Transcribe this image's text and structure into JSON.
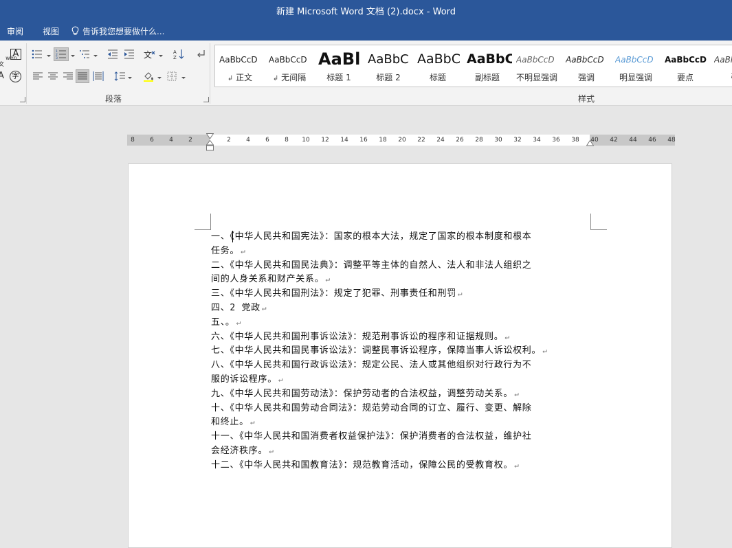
{
  "window": {
    "title": "新建 Microsoft Word 文档 (2).docx - Word"
  },
  "tabs": [
    {
      "label": "审阅"
    },
    {
      "label": "视图"
    }
  ],
  "tell_me": {
    "placeholder": "告诉我您想要做什么..."
  },
  "ribbon": {
    "paragraph_group": {
      "label": "段落"
    },
    "styles_group": {
      "label": "样式"
    },
    "partial_font_glyphs": {
      "phonetic": "wén\n文",
      "char_border": "A",
      "enclose": "字",
      "small_a": "A"
    }
  },
  "styles": [
    {
      "sample": "AaBbCcD",
      "name": "正文",
      "mark": "↲"
    },
    {
      "sample": "AaBbCcD",
      "name": "无间隔",
      "mark": "↲"
    },
    {
      "sample": "AaBl",
      "name": "标题 1",
      "mark": ""
    },
    {
      "sample": "AaBbC",
      "name": "标题 2",
      "mark": ""
    },
    {
      "sample": "AaBbC",
      "name": "标题",
      "mark": ""
    },
    {
      "sample": "AaBbC",
      "name": "副标题",
      "mark": ""
    },
    {
      "sample": "AaBbCcD",
      "name": "不明显强调",
      "mark": ""
    },
    {
      "sample": "AaBbCcD",
      "name": "强调",
      "mark": ""
    },
    {
      "sample": "AaBbCcD",
      "name": "明显强调",
      "mark": ""
    },
    {
      "sample": "AaBbCcD",
      "name": "要点",
      "mark": ""
    },
    {
      "sample": "AaBl",
      "name": "引",
      "mark": ""
    }
  ],
  "ruler": {
    "left_numbers": [
      "8",
      "6",
      "4",
      "2"
    ],
    "right_numbers": [
      "2",
      "4",
      "6",
      "8",
      "10",
      "12",
      "14",
      "16",
      "18",
      "20",
      "22",
      "24",
      "26",
      "28",
      "30",
      "32",
      "34",
      "36",
      "38",
      "40",
      "42",
      "44",
      "46",
      "48"
    ]
  },
  "document": {
    "paragraph_mark": "↵",
    "lines": [
      "一、《中华人民共和国宪法》：国家的根本大法，规定了国家的根本制度和根本",
      "任务。",
      "二、《中华人民共和国民法典》：调整平等主体的自然人、法人和非法人组织之",
      "间的人身关系和财产关系。",
      "三、《中华人民共和国刑法》：规定了犯罪、刑事责任和刑罚",
      "四、2 党政",
      "五、。",
      "六、《中华人民共和国刑事诉讼法》：规范刑事诉讼的程序和证据规则。",
      "七、《中华人民共和国民事诉讼法》：调整民事诉讼程序，保障当事人诉讼权利。",
      "八、《中华人民共和国行政诉讼法》：规定公民、法人或其他组织对行政行为不",
      "服的诉讼程序。",
      "九、《中华人民共和国劳动法》：保护劳动者的合法权益，调整劳动关系。",
      "十、《中华人民共和国劳动合同法》：规范劳动合同的订立、履行、变更、解除",
      "和终止。",
      "十一、《中华人民共和国消费者权益保护法》：保护消费者的合法权益，维护社",
      "会经济秩序。",
      "十二、《中华人民共和国教育法》：规范教育活动，保障公民的受教育权。"
    ],
    "line_marks": [
      false,
      true,
      false,
      true,
      true,
      true,
      true,
      true,
      true,
      false,
      true,
      true,
      false,
      true,
      false,
      true,
      true
    ]
  },
  "colors": {
    "title_bar": "#2b579a",
    "ribbon_bg": "#f3f3f3",
    "workspace_bg": "#e6e6e6",
    "page_bg": "#ffffff"
  }
}
